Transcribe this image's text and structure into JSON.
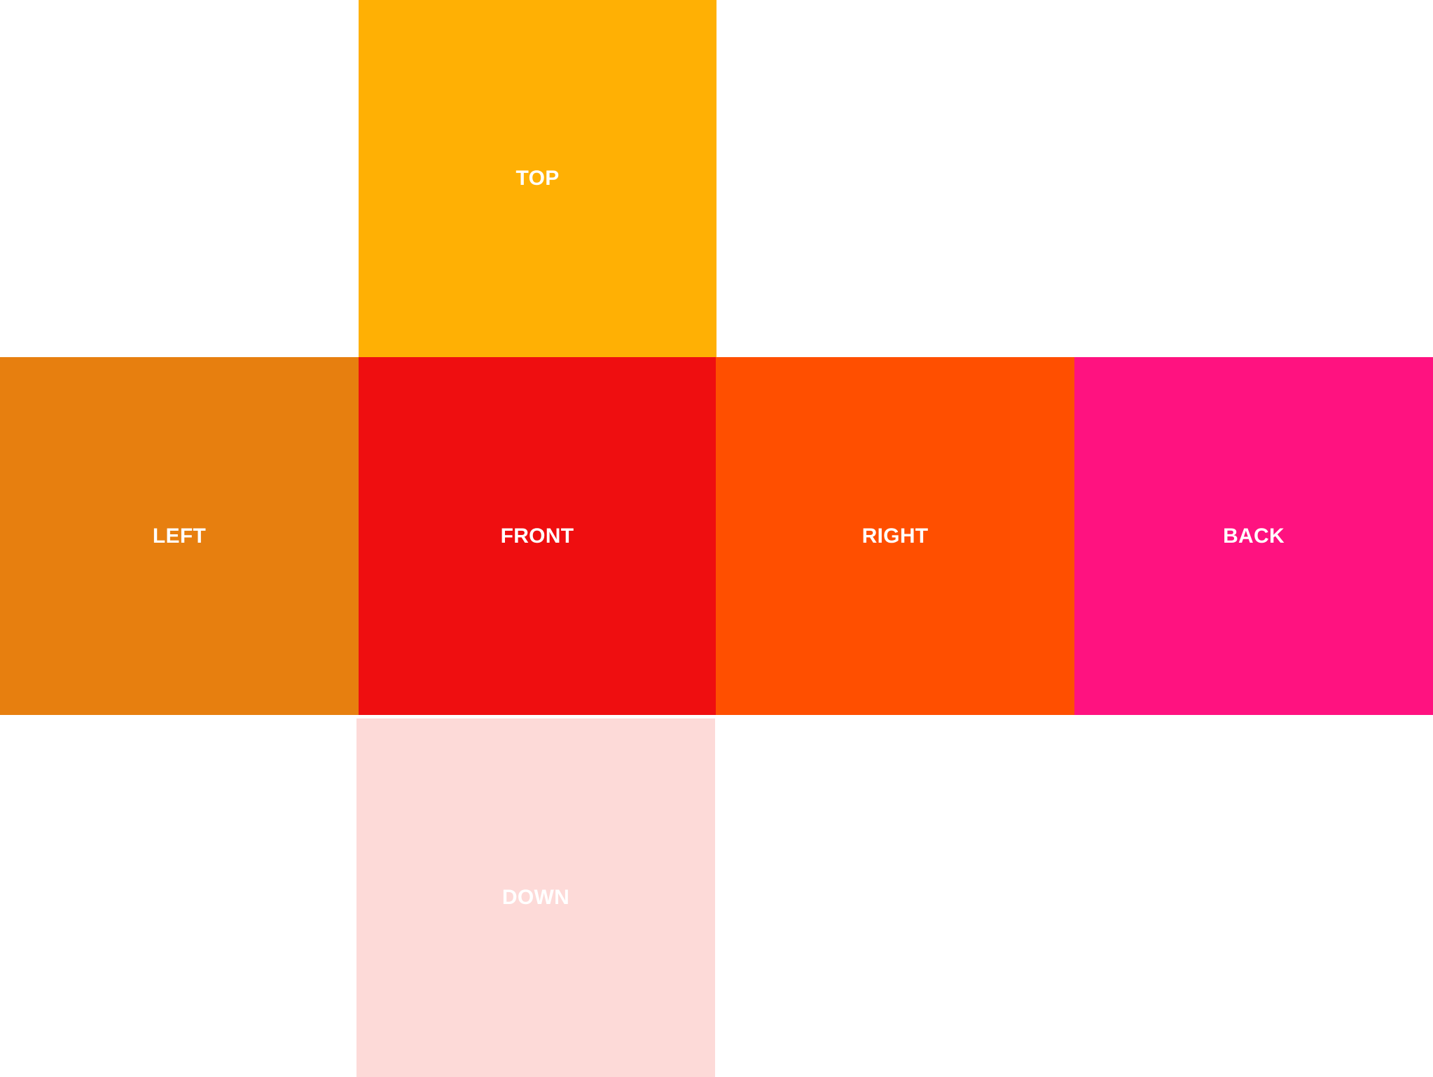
{
  "cube_net": {
    "faces": {
      "top": {
        "label": "TOP",
        "color": "#FFB004"
      },
      "left": {
        "label": "LEFT",
        "color": "#E77F0F"
      },
      "front": {
        "label": "FRONT",
        "color": "#EF0E10"
      },
      "right": {
        "label": "RIGHT",
        "color": "#FF4F00"
      },
      "back": {
        "label": "BACK",
        "color": "#FF1280"
      },
      "down": {
        "label": "DOWN",
        "color": "#FDDAD8"
      }
    }
  }
}
